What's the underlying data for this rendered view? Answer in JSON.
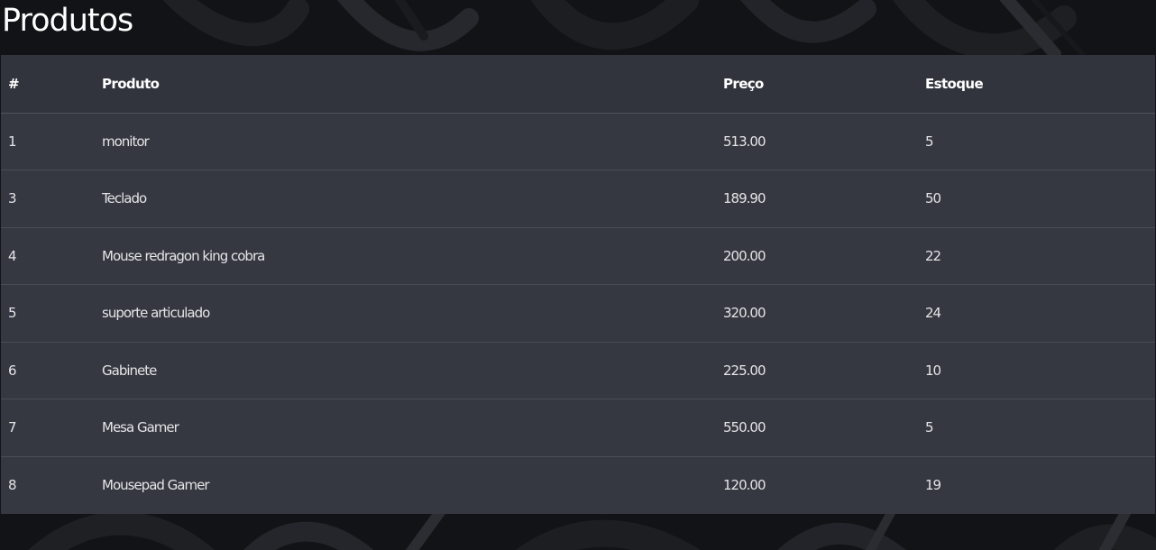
{
  "page": {
    "title": "Produtos"
  },
  "colors": {
    "background": "#111214",
    "table_background": "#353840",
    "header_background": "#31343c",
    "text": "#ffffff"
  },
  "table": {
    "headers": [
      "#",
      "Produto",
      "Preço",
      "Estoque"
    ],
    "rows": [
      {
        "id": "1",
        "produto": "monitor",
        "preco": "513.00",
        "estoque": "5"
      },
      {
        "id": "3",
        "produto": "Teclado",
        "preco": "189.90",
        "estoque": "50"
      },
      {
        "id": "4",
        "produto": "Mouse redragon king cobra",
        "preco": "200.00",
        "estoque": "22"
      },
      {
        "id": "5",
        "produto": "suporte articulado",
        "preco": "320.00",
        "estoque": "24"
      },
      {
        "id": "6",
        "produto": "Gabinete",
        "preco": "225.00",
        "estoque": "10"
      },
      {
        "id": "7",
        "produto": "Mesa Gamer",
        "preco": "550.00",
        "estoque": "5"
      },
      {
        "id": "8",
        "produto": "Mousepad Gamer",
        "preco": "120.00",
        "estoque": "19"
      }
    ]
  }
}
